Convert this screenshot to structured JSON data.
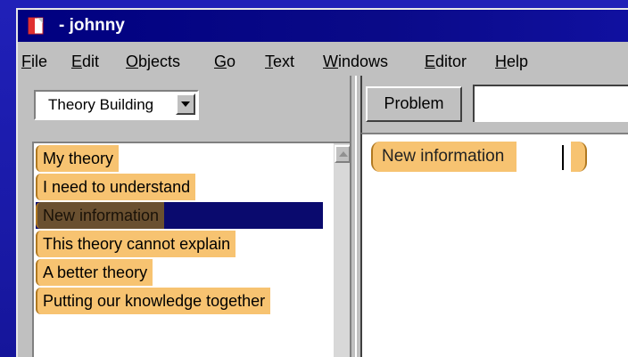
{
  "window": {
    "title": "- johnny",
    "icon": "document-icon"
  },
  "menu": {
    "items": [
      {
        "accel": "F",
        "rest": "ile"
      },
      {
        "accel": "E",
        "rest": "dit"
      },
      {
        "accel": "O",
        "rest": "bjects"
      },
      {
        "accel": "G",
        "rest": "o"
      },
      {
        "accel": "T",
        "rest": "ext"
      },
      {
        "accel": "W",
        "rest": "indows"
      },
      {
        "accel": "E",
        "rest": "ditor"
      },
      {
        "accel": "H",
        "rest": "elp"
      }
    ]
  },
  "scaffold_selector": {
    "value": "Theory Building"
  },
  "scaffold_list": {
    "items": [
      {
        "label": "My theory"
      },
      {
        "label": "I need to understand"
      },
      {
        "label": "New information",
        "selected": true
      },
      {
        "label": "This theory cannot explain"
      },
      {
        "label": "A better theory"
      },
      {
        "label": "Putting our knowledge together"
      }
    ]
  },
  "problem": {
    "button_label": "Problem",
    "value": ""
  },
  "editor": {
    "scaffold_tag": "New information"
  },
  "colors": {
    "scaffold_tag": "#f7c371",
    "selection": "#0a0a6e",
    "title_bar": "#000080",
    "slide_background": "#1a1aa8"
  }
}
